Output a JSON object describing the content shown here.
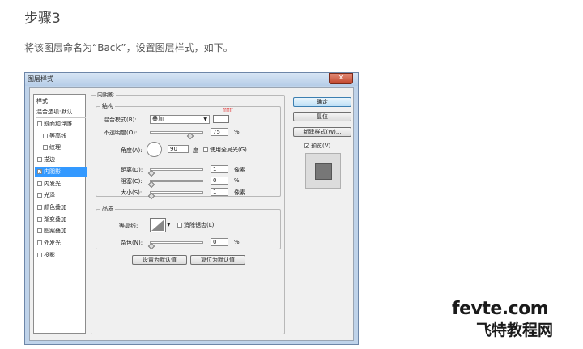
{
  "article": {
    "step_title": "步骤3",
    "step_desc": "将该图层命名为“Back”，设置图层样式，如下。"
  },
  "dialog": {
    "title": "图层样式",
    "close_glyph": "x",
    "style_list": {
      "header": "样式",
      "blend_default": "混合选项:默认",
      "items": [
        {
          "label": "斜面和浮雕",
          "checked": false,
          "indent": false
        },
        {
          "label": "等高线",
          "checked": false,
          "indent": true
        },
        {
          "label": "纹理",
          "checked": false,
          "indent": true
        },
        {
          "label": "描边",
          "checked": false,
          "indent": false
        },
        {
          "label": "内阴影",
          "checked": true,
          "indent": false,
          "selected": true
        },
        {
          "label": "内发光",
          "checked": false,
          "indent": false
        },
        {
          "label": "光泽",
          "checked": false,
          "indent": false
        },
        {
          "label": "颜色叠加",
          "checked": false,
          "indent": false
        },
        {
          "label": "渐变叠加",
          "checked": false,
          "indent": false
        },
        {
          "label": "图案叠加",
          "checked": false,
          "indent": false
        },
        {
          "label": "外发光",
          "checked": false,
          "indent": false
        },
        {
          "label": "投影",
          "checked": false,
          "indent": false
        }
      ]
    },
    "inner_shadow": {
      "section_title": "内阴影",
      "structure": {
        "title": "结构",
        "blend_mode_label": "混合模式(B):",
        "blend_mode_value": "叠加",
        "color_hex": "#ffffff",
        "color_note": "ffffff",
        "opacity_label": "不透明度(O):",
        "opacity_value": "75",
        "opacity_unit": "%",
        "opacity_level": 0.75,
        "angle_label": "角度(A):",
        "angle_value": "90",
        "angle_unit": "度",
        "global_light_label": "使用全局光(G)",
        "distance_label": "距离(D):",
        "distance_value": "1",
        "distance_unit": "像素",
        "choke_label": "阻塞(C):",
        "choke_value": "0",
        "choke_unit": "%",
        "size_label": "大小(S):",
        "size_value": "1",
        "size_unit": "像素"
      },
      "quality": {
        "title": "品质",
        "contour_label": "等高线:",
        "antialias_label": "消除锯齿(L)",
        "noise_label": "杂色(N):",
        "noise_value": "0",
        "noise_unit": "%"
      },
      "make_default": "设置为默认值",
      "reset_default": "复位为默认值"
    },
    "buttons": {
      "ok": "确定",
      "cancel": "复位",
      "new_style": "新建样式(W)...",
      "preview_label": "预览(V)",
      "preview_checked": true
    }
  },
  "watermark": {
    "top": "fevte.com",
    "bottom": "飞特教程网"
  }
}
